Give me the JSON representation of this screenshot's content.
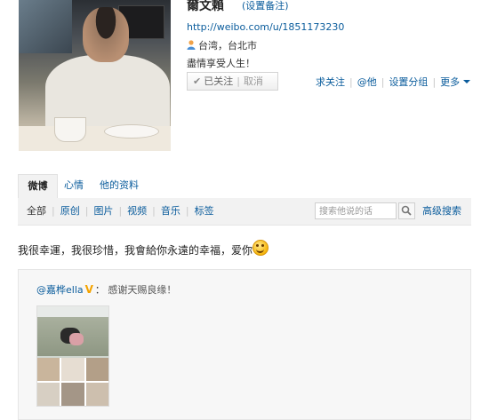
{
  "profile": {
    "name": "爾文賴",
    "remark_link": "(设置备注)",
    "url": "http://weibo.com/u/1851173230",
    "location": "台湾，台北市",
    "bio": "盡情享受人生！",
    "follow_status": "已关注",
    "cancel": "取消",
    "actions": [
      "求关注",
      "@他",
      "设置分组",
      "更多"
    ]
  },
  "tabs": [
    "微博",
    "心情",
    "他的资料"
  ],
  "filters": [
    "全部",
    "原创",
    "图片",
    "视频",
    "音乐",
    "标签"
  ],
  "search": {
    "placeholder": "搜索他说的话",
    "advanced": "高级搜索"
  },
  "post": {
    "text": "我很幸運，我很珍惜，我會給你永遠的幸福，爱你",
    "emoji": "smile-emoji",
    "quote": {
      "author": "@嘉桦ella",
      "badge": "V",
      "separator": "：",
      "text": "感谢天赐良缘！"
    }
  },
  "colors": {
    "link": "#0a5c9c",
    "badge": "#f4a300"
  }
}
